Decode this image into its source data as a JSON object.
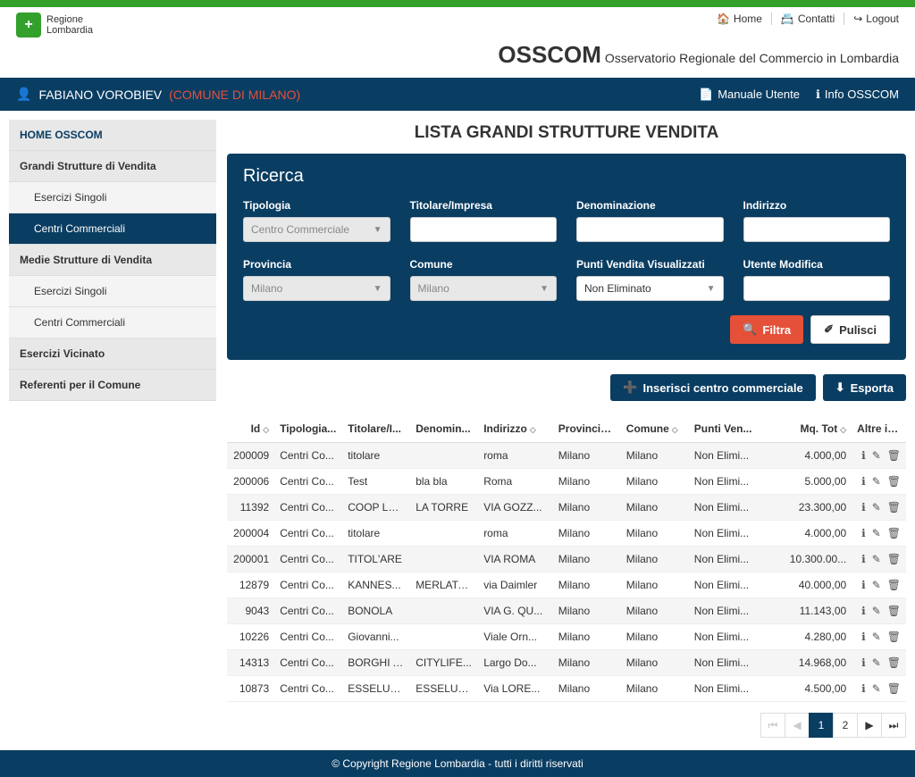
{
  "header": {
    "region_line1": "Regione",
    "region_line2": "Lombardia",
    "links": {
      "home": "Home",
      "contatti": "Contatti",
      "logout": "Logout"
    },
    "app_abbr": "OSSCOM",
    "app_full": "Osservatorio Regionale del Commercio in Lombardia"
  },
  "userbar": {
    "user": "FABIANO VOROBIEV",
    "org": "(COMUNE DI MILANO)",
    "manual": "Manuale Utente",
    "info": "Info OSSCOM"
  },
  "sidebar": {
    "home": "HOME OSSCOM",
    "grandi": "Grandi Strutture di Vendita",
    "esercizi1": "Esercizi Singoli",
    "centri1": "Centri Commerciali",
    "medie": "Medie Strutture di Vendita",
    "esercizi2": "Esercizi Singoli",
    "centri2": "Centri Commerciali",
    "vicinato": "Esercizi Vicinato",
    "referenti": "Referenti per il Comune"
  },
  "page": {
    "title": "LISTA GRANDI STRUTTURE VENDITA"
  },
  "search": {
    "heading": "Ricerca",
    "tipologia_label": "Tipologia",
    "tipologia_value": "Centro Commerciale",
    "titolare_label": "Titolare/Impresa",
    "denom_label": "Denominazione",
    "indirizzo_label": "Indirizzo",
    "provincia_label": "Provincia",
    "provincia_value": "Milano",
    "comune_label": "Comune",
    "comune_value": "Milano",
    "punti_label": "Punti Vendita Visualizzati",
    "punti_value": "Non Eliminato",
    "utente_label": "Utente Modifica",
    "btn_filtra": "Filtra",
    "btn_pulisci": "Pulisci"
  },
  "actions": {
    "insert": "Inserisci centro commerciale",
    "export": "Esporta"
  },
  "table": {
    "cols": {
      "id": "Id",
      "tipologia": "Tipologia...",
      "titolare": "Titolare/I...",
      "denom": "Denomin...",
      "indirizzo": "Indirizzo",
      "provincia": "Provincia...",
      "comune": "Comune",
      "punti": "Punti Ven...",
      "mq": "Mq. Tot",
      "altre": "Altre info"
    },
    "rows": [
      {
        "id": "200009",
        "tip": "Centri Co...",
        "tit": "titolare",
        "den": "",
        "ind": "roma",
        "prov": "Milano",
        "com": "Milano",
        "pun": "Non Elimi...",
        "mq": "4.000,00"
      },
      {
        "id": "200006",
        "tip": "Centri Co...",
        "tit": "Test",
        "den": "bla bla",
        "ind": "Roma",
        "prov": "Milano",
        "com": "Milano",
        "pun": "Non Elimi...",
        "mq": "5.000,00"
      },
      {
        "id": "11392",
        "tip": "Centri Co...",
        "tit": "COOP LO...",
        "den": "LA TORRE",
        "ind": "VIA GOZZ...",
        "prov": "Milano",
        "com": "Milano",
        "pun": "Non Elimi...",
        "mq": "23.300,00"
      },
      {
        "id": "200004",
        "tip": "Centri Co...",
        "tit": "titolare",
        "den": "",
        "ind": "roma",
        "prov": "Milano",
        "com": "Milano",
        "pun": "Non Elimi...",
        "mq": "4.000,00"
      },
      {
        "id": "200001",
        "tip": "Centri Co...",
        "tit": "TITOL'ARE",
        "den": "",
        "ind": "VIA ROMA",
        "prov": "Milano",
        "com": "Milano",
        "pun": "Non Elimi...",
        "mq": "10.300.00..."
      },
      {
        "id": "12879",
        "tip": "Centri Co...",
        "tit": "KANNES...",
        "den": "MERLATA...",
        "ind": "via Daimler",
        "prov": "Milano",
        "com": "Milano",
        "pun": "Non Elimi...",
        "mq": "40.000,00"
      },
      {
        "id": "9043",
        "tip": "Centri Co...",
        "tit": "BONOLA",
        "den": "",
        "ind": "VIA G. QU...",
        "prov": "Milano",
        "com": "Milano",
        "pun": "Non Elimi...",
        "mq": "11.143,00"
      },
      {
        "id": "10226",
        "tip": "Centri Co...",
        "tit": "Giovanni...",
        "den": "",
        "ind": "Viale Orn...",
        "prov": "Milano",
        "com": "Milano",
        "pun": "Non Elimi...",
        "mq": "4.280,00"
      },
      {
        "id": "14313",
        "tip": "Centri Co...",
        "tit": "BORGHI A...",
        "den": "CITYLIFE...",
        "ind": "Largo Do...",
        "prov": "Milano",
        "com": "Milano",
        "pun": "Non Elimi...",
        "mq": "14.968,00"
      },
      {
        "id": "10873",
        "tip": "Centri Co...",
        "tit": "ESSELUN...",
        "den": "ESSELUN...",
        "ind": "Via LORE...",
        "prov": "Milano",
        "com": "Milano",
        "pun": "Non Elimi...",
        "mq": "4.500,00"
      }
    ]
  },
  "pagination": {
    "p1": "1",
    "p2": "2"
  },
  "footer": "© Copyright Regione Lombardia - tutti i diritti riservati"
}
